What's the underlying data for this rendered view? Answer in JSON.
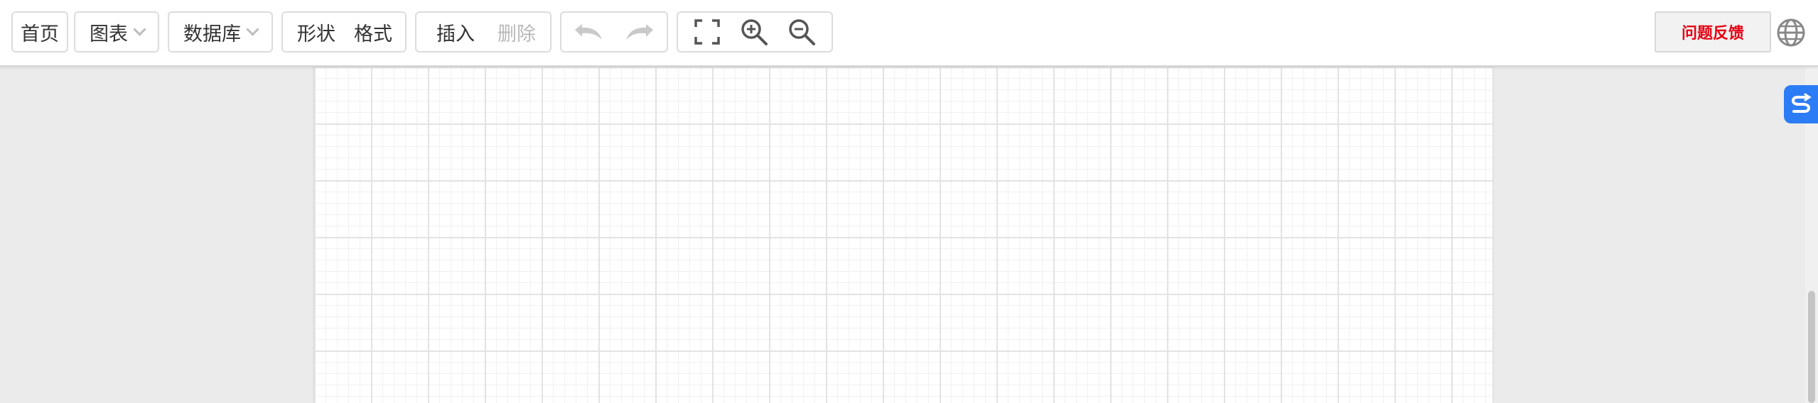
{
  "toolbar": {
    "home_label": "首页",
    "chart_label": "图表",
    "database_label": "数据库",
    "shape_label": "形状",
    "format_label": "格式",
    "insert_label": "插入",
    "delete_label": "删除",
    "feedback_label": "问题反馈"
  },
  "icons": {
    "undo": "undo-icon",
    "redo": "redo-icon",
    "fullscreen": "fullscreen-icon",
    "zoom_in": "zoom-in-icon",
    "zoom_out": "zoom-out-icon",
    "language": "globe-icon",
    "badge": "s-logo-icon"
  },
  "colors": {
    "feedback_text": "#e60012",
    "badge_bg": "#2c7cf6",
    "disabled_icon": "#c9c9c9",
    "active_icon": "#555555"
  }
}
